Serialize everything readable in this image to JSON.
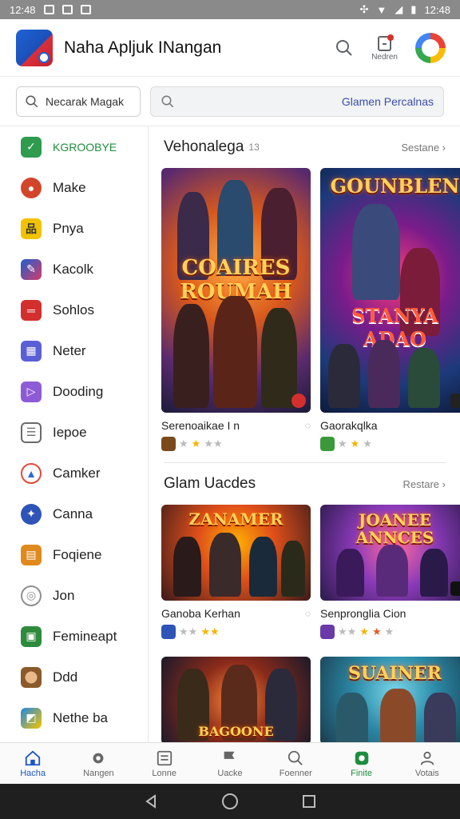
{
  "status_bar": {
    "time": "12:48",
    "clock_right": "12:48"
  },
  "app_bar": {
    "title": "Naha Apljuk INangan",
    "notifications_label": "Nedren"
  },
  "search": {
    "left_placeholder": "Necarak Magak",
    "right_placeholder": "Glamen Percalnas"
  },
  "sidebar": {
    "items": [
      {
        "label": "KGROOBYE",
        "icon": "tag-icon",
        "color": "#2e9b4f"
      },
      {
        "label": "Make",
        "icon": "record-icon",
        "color": "#d2452a"
      },
      {
        "label": "Pnya",
        "icon": "puzzle-icon",
        "color": "#f2c200"
      },
      {
        "label": "Kacolk",
        "icon": "pen-icon",
        "color": "#1f5fcf"
      },
      {
        "label": "Sohlos",
        "icon": "card-icon",
        "color": "#d32f2f"
      },
      {
        "label": "Neter",
        "icon": "grid-icon",
        "color": "#5b5fd6"
      },
      {
        "label": "Dooding",
        "icon": "chat-icon",
        "color": "#8e5bd6"
      },
      {
        "label": "Iepoe",
        "icon": "doc-icon",
        "color": "#6a6a6a"
      },
      {
        "label": "Camker",
        "icon": "triangle-icon",
        "color": "#2f6ad8"
      },
      {
        "label": "Canna",
        "icon": "globe-icon",
        "color": "#2f54b8"
      },
      {
        "label": "Foqiene",
        "icon": "calendar-icon",
        "color": "#e08a1e"
      },
      {
        "label": "Jon",
        "icon": "circle-icon",
        "color": "#8f8f8f"
      },
      {
        "label": "Femineapt",
        "icon": "sheet-icon",
        "color": "#2e8b3d"
      },
      {
        "label": "Ddd",
        "icon": "face-icon",
        "color": "#b8772f"
      },
      {
        "label": "Nethe ba",
        "icon": "photo-icon",
        "color": "#1e88e5"
      }
    ]
  },
  "sections": [
    {
      "title": "Vehonalega",
      "badge": "13",
      "more": "Sestane",
      "cards": [
        {
          "name": "Serenoaikae I n",
          "art_title": "COAIRES ROUMAH",
          "art_sub": "",
          "theme": "orange",
          "rating_on": 1,
          "rating_off": 2
        },
        {
          "name": "Gaorakqlka",
          "art_title": "GOUNBLEN",
          "art_sub": "STANYA ADAO",
          "theme": "blue",
          "rating_on": 1,
          "rating_off": 2
        }
      ]
    },
    {
      "title": "Glam Uacdes",
      "badge": "",
      "more": "Restare",
      "cards": [
        {
          "name": "Ganoba Kerhan",
          "art_title": "ZANAMER",
          "art_sub": "",
          "theme": "fire",
          "rating_on": 2,
          "rating_off": 1
        },
        {
          "name": "Senpronglia Cion",
          "art_title": "JOANEE ANNCES",
          "art_sub": "",
          "theme": "purple",
          "rating_on": 1,
          "rating_off": 2
        }
      ]
    },
    {
      "cards": [
        {
          "art_title": "BAGOONE",
          "theme": "battle"
        },
        {
          "art_title": "SUAINER",
          "theme": "teal"
        }
      ]
    }
  ],
  "bottom_nav": [
    {
      "label": "Hacha",
      "icon": "home-icon"
    },
    {
      "label": "Nangen",
      "icon": "gear-icon"
    },
    {
      "label": "Lonne",
      "icon": "list-icon"
    },
    {
      "label": "Uacke",
      "icon": "flag-icon"
    },
    {
      "label": "Foenner",
      "icon": "search-icon"
    },
    {
      "label": "Finite",
      "icon": "games-icon"
    },
    {
      "label": "Votais",
      "icon": "person-icon"
    }
  ]
}
